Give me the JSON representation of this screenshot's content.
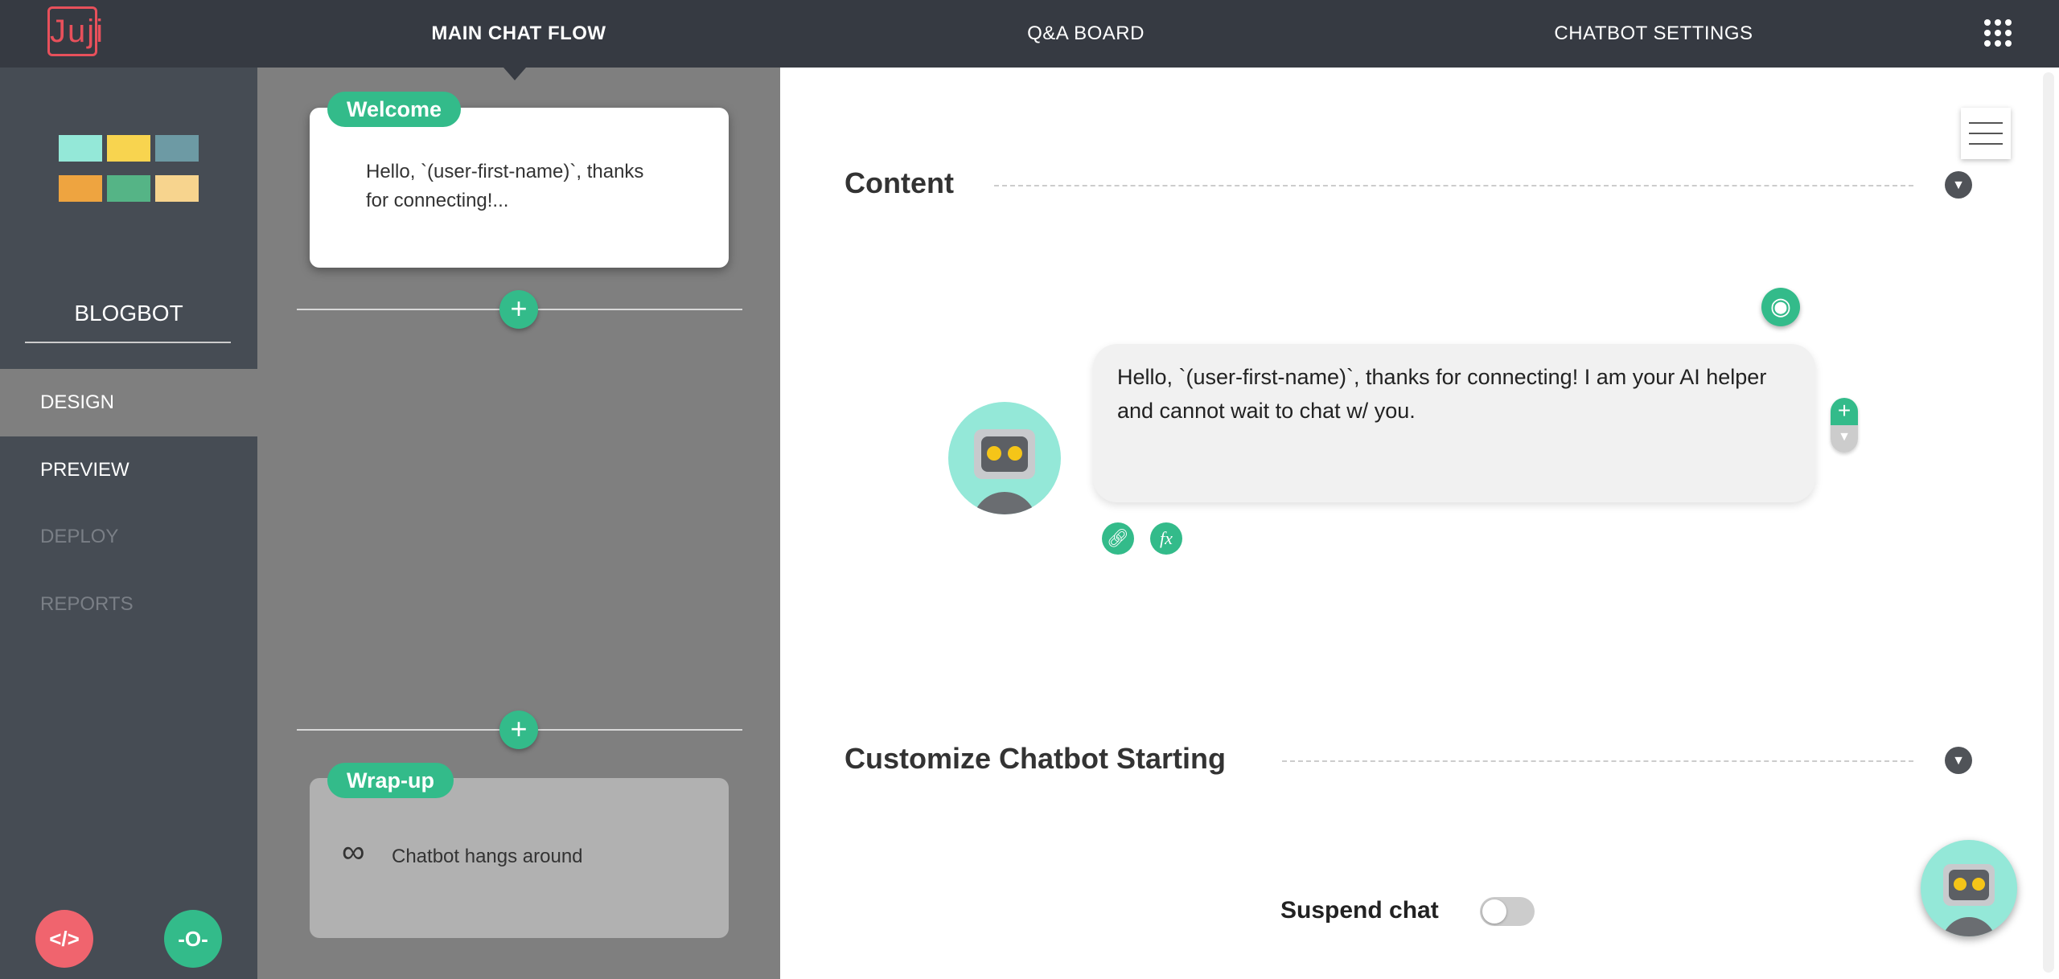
{
  "header": {
    "logo": "Juji",
    "tabs": [
      {
        "label": "MAIN CHAT FLOW",
        "active": true
      },
      {
        "label": "Q&A BOARD"
      },
      {
        "label": "CHATBOT SETTINGS"
      }
    ],
    "apps_icon": "grid-icon"
  },
  "sidebar": {
    "bot_name": "BLOGBOT",
    "items": [
      {
        "label": "DESIGN",
        "active": true
      },
      {
        "label": "PREVIEW"
      },
      {
        "label": "DEPLOY",
        "disabled": true
      },
      {
        "label": "REPORTS",
        "disabled": true
      }
    ],
    "code_button": "</>",
    "toggle_button": "-O-"
  },
  "flow": {
    "welcome": {
      "badge": "Welcome",
      "text": "Hello, `(user-first-name)`, thanks for connecting!..."
    },
    "wrapup": {
      "badge": "Wrap-up",
      "text": "Chatbot hangs around"
    }
  },
  "content": {
    "section1": "Content",
    "message": "Hello, `(user-first-name)`, thanks for connecting! I am your AI helper and cannot wait to chat w/ you.",
    "section2": "Customize Chatbot Starting",
    "suspend_label": "Suspend chat",
    "suspend_on": false
  },
  "colors": {
    "accent": "#33bb8a",
    "danger": "#f0646e",
    "topbar": "#363a42",
    "sidebar": "#464c54"
  }
}
